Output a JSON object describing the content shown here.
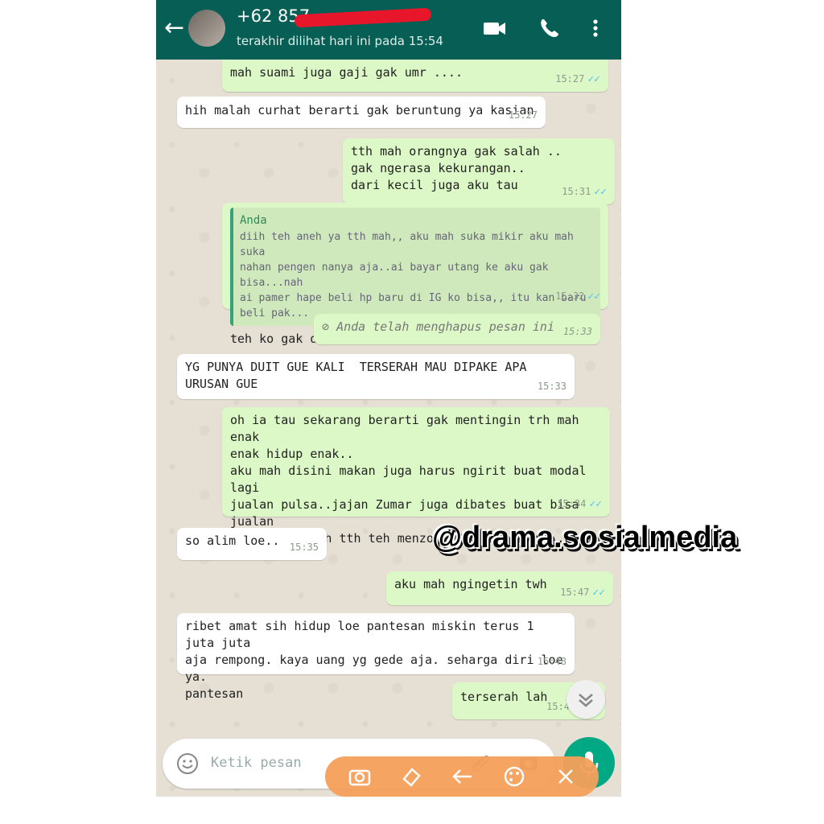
{
  "header": {
    "contact": "+62 857 ",
    "status": "terakhir dilihat hari ini pada 15:54"
  },
  "messages": [
    {
      "dir": "out",
      "text": "mah suami juga gaji gak umr ....",
      "time": "15:27",
      "ticks": "✓✓"
    },
    {
      "dir": "in",
      "text": "hih malah curhat berarti gak beruntung ya kasian",
      "time": "15:27"
    },
    {
      "dir": "out",
      "text": "tth mah orangnya gak salah ..\ngak ngerasa kekurangan..\ndari kecil juga aku tau",
      "time": "15:31",
      "ticks": "✓✓"
    },
    {
      "dir": "out",
      "quote_name": "Anda",
      "quote_text": "diih teh aneh ya tth mah,, aku mah suka mikir aku mah suka\nnahan pengen nanya aja..ai bayar utang ke aku gak bisa...nah\nai pamer hape beli hp baru di IG ko bisa,, itu kan baru beli pak...",
      "text": "teh ko gak dibales ini",
      "time": "15:32",
      "ticks": "✓✓"
    },
    {
      "dir": "out",
      "deleted": true,
      "text": "Anda telah menghapus pesan ini",
      "time": "15:33"
    },
    {
      "dir": "in",
      "text": "YG PUNYA DUIT GUE KALI  TERSERAH MAU DIPAKE APA\nURUSAN GUE",
      "time": "15:33"
    },
    {
      "dir": "out",
      "text": "oh ia tau sekarang berarti gak mentingin trh mah enak\nenak hidup enak..\naku mah disini makan juga harus ngirit buat modal lagi\njualan pulsa..jajan Zumar juga dibates buat bisa jualan\nlagi..sadr teh tth teh menzolimi orang lain...bisi diazab",
      "time": "15:34",
      "ticks": "✓✓"
    },
    {
      "dir": "in",
      "text": "so alim loe..",
      "time": "15:35"
    },
    {
      "dir": "out",
      "text": "aku mah ngingetin twh",
      "time": "15:47",
      "ticks": "✓✓"
    },
    {
      "dir": "in",
      "text": "ribet amat sih hidup loe pantesan miskin terus 1 juta juta\naja rempong. kaya uang yg gede aja. seharga diri loe ya.\npantesan",
      "time": "15:48"
    },
    {
      "dir": "out",
      "text": "terserah lah",
      "time": "15:4"
    }
  ],
  "watermark": "@drama.sosialmedia",
  "input": {
    "placeholder": "Ketik pesan"
  },
  "icons": [
    "back-arrow-icon",
    "video-call-icon",
    "phone-icon",
    "more-vert-icon",
    "smiley-icon",
    "attach-icon",
    "camera-icon",
    "mic-icon",
    "chevron-down-icon"
  ],
  "colors": {
    "header": "#075e54",
    "outgoing": "#dcf8c6",
    "incoming": "#ffffff",
    "accent": "#00a884",
    "toolbar": "#f5a05a"
  }
}
